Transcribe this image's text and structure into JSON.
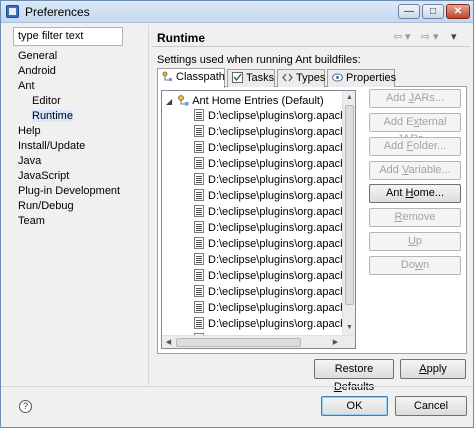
{
  "window": {
    "title": "Preferences",
    "minimize_glyph": "—",
    "maximize_glyph": "□",
    "close_glyph": "✕"
  },
  "filter": {
    "value": "type filter text"
  },
  "tree": [
    {
      "label": "General",
      "indent": 0,
      "expander": ""
    },
    {
      "label": "Android",
      "indent": 0,
      "expander": ""
    },
    {
      "label": "Ant",
      "indent": 0,
      "expander": ""
    },
    {
      "label": "Editor",
      "indent": 1,
      "expander": ""
    },
    {
      "label": "Runtime",
      "indent": 1,
      "expander": "",
      "selected": true
    },
    {
      "label": "Help",
      "indent": 0,
      "expander": ""
    },
    {
      "label": "Install/Update",
      "indent": 0,
      "expander": ""
    },
    {
      "label": "Java",
      "indent": 0,
      "expander": ""
    },
    {
      "label": "JavaScript",
      "indent": 0,
      "expander": ""
    },
    {
      "label": "Plug-in Development",
      "indent": 0,
      "expander": ""
    },
    {
      "label": "Run/Debug",
      "indent": 0,
      "expander": ""
    },
    {
      "label": "Team",
      "indent": 0,
      "expander": ""
    }
  ],
  "page": {
    "title": "Runtime",
    "description": "Settings used when running Ant buildfiles:",
    "nav": {
      "back": "⇦",
      "back_menu": "▾",
      "forward": "⇨",
      "forward_menu": "▾",
      "menu": "▾"
    }
  },
  "tabs": [
    {
      "label": "Classpath",
      "icon": "classpath-icon",
      "active": true
    },
    {
      "label": "Tasks",
      "icon": "tasks-icon",
      "active": false
    },
    {
      "label": "Types",
      "icon": "types-icon",
      "active": false
    },
    {
      "label": "Properties",
      "icon": "properties-icon",
      "active": false
    }
  ],
  "classpath": {
    "root": {
      "label": "Ant Home Entries (Default)",
      "expander": "◢"
    },
    "entries": [
      "D:\\eclipse\\plugins\\org.apache.ant",
      "D:\\eclipse\\plugins\\org.apache.ant",
      "D:\\eclipse\\plugins\\org.apache.ant",
      "D:\\eclipse\\plugins\\org.apache.ant",
      "D:\\eclipse\\plugins\\org.apache.ant",
      "D:\\eclipse\\plugins\\org.apache.ant",
      "D:\\eclipse\\plugins\\org.apache.ant",
      "D:\\eclipse\\plugins\\org.apache.ant",
      "D:\\eclipse\\plugins\\org.apache.ant",
      "D:\\eclipse\\plugins\\org.apache.ant",
      "D:\\eclipse\\plugins\\org.apache.ant",
      "D:\\eclipse\\plugins\\org.apache.ant",
      "D:\\eclipse\\plugins\\org.apache.ant",
      "D:\\eclipse\\plugins\\org.apache.ant",
      "D:\\eclipse\\plugins\\org.apache.ant"
    ]
  },
  "side_buttons": [
    {
      "pre": "Add ",
      "mn": "J",
      "post": "ARs...",
      "enabled": false
    },
    {
      "pre": "Add E",
      "mn": "x",
      "post": "ternal JARs...",
      "enabled": false
    },
    {
      "pre": "Add ",
      "mn": "F",
      "post": "older...",
      "enabled": false
    },
    {
      "pre": "Add ",
      "mn": "V",
      "post": "ariable...",
      "enabled": false
    },
    {
      "pre": "Ant ",
      "mn": "H",
      "post": "ome...",
      "enabled": true
    },
    {
      "pre": "",
      "mn": "R",
      "post": "emove",
      "enabled": false
    },
    {
      "pre": "",
      "mn": "U",
      "post": "p",
      "enabled": false
    },
    {
      "pre": "Do",
      "mn": "w",
      "post": "n",
      "enabled": false
    }
  ],
  "restore_defaults": {
    "pre": "Restore ",
    "mn": "D",
    "post": "efaults"
  },
  "apply": {
    "pre": "",
    "mn": "A",
    "post": "pply"
  },
  "ok": "OK",
  "cancel": "Cancel",
  "help_glyph": "?",
  "colors": {
    "selection": "#d8e7fb",
    "default_button_border": "#3c7fb1"
  }
}
